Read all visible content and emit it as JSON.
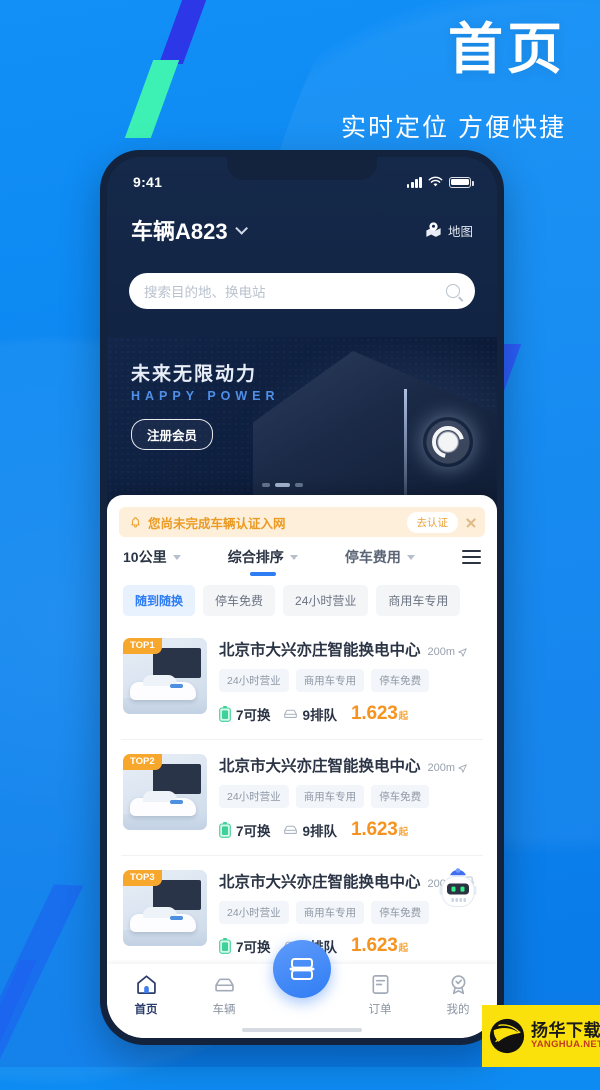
{
  "hero": {
    "title": "首页",
    "subtitle": "实时定位 方便快捷"
  },
  "colors": {
    "page_bg": "#0e8bf2",
    "stripe_dark_blue": "#2c37e8",
    "stripe_mint": "#3df1b4",
    "accent_blue": "#2f7df4",
    "price_orange": "#f5931e",
    "notice_bg": "#fdefd9",
    "notice_text": "#eb9b24",
    "badge_orange": "#f7a72c"
  },
  "phone": {
    "status": {
      "time": "9:41",
      "signal_icon": "signal-bars-icon",
      "wifi_icon": "wifi-icon",
      "battery_icon": "battery-icon"
    },
    "appbar": {
      "vehicle": "车辆A823",
      "chevron_icon": "chevron-down-icon",
      "map_label": "地图",
      "map_icon": "map-pin-icon"
    },
    "search": {
      "placeholder": "搜索目的地、换电站",
      "value": "",
      "icon": "search-icon"
    },
    "banner": {
      "title": "未来无限动力",
      "subtitle_en": "HAPPY POWER",
      "cta": "注册会员",
      "logo_icon": "brand-logo-icon"
    },
    "notice": {
      "icon": "bell-icon",
      "text": "您尚未完成车辆认证入网",
      "action": "去认证",
      "close_icon": "close-icon"
    },
    "filters": [
      {
        "label": "10公里",
        "active": false,
        "caret_icon": "caret-down-icon"
      },
      {
        "label": "综合排序",
        "active": true,
        "caret_icon": "caret-down-icon"
      },
      {
        "label": "停车费用",
        "active": false,
        "caret_icon": "caret-down-icon"
      }
    ],
    "filter_menu_icon": "hamburger-menu-icon",
    "chips": [
      {
        "label": "随到随换",
        "selected": true
      },
      {
        "label": "停车免费",
        "selected": false
      },
      {
        "label": "24小时营业",
        "selected": false
      },
      {
        "label": "商用车专用",
        "selected": false
      }
    ],
    "stations": [
      {
        "badge": "TOP1",
        "title": "北京市大兴亦庄智能换电中心",
        "distance": "200m",
        "tags": [
          "24小时营业",
          "商用车专用",
          "停车免费"
        ],
        "available_label": "7可换",
        "queue_label": "9排队",
        "price": "1.623",
        "price_suffix": "起"
      },
      {
        "badge": "TOP2",
        "title": "北京市大兴亦庄智能换电中心",
        "distance": "200m",
        "tags": [
          "24小时营业",
          "商用车专用",
          "停车免费"
        ],
        "available_label": "7可换",
        "queue_label": "9排队",
        "price": "1.623",
        "price_suffix": "起"
      },
      {
        "badge": "TOP3",
        "title": "北京市大兴亦庄智能换电中心",
        "distance": "200m",
        "tags": [
          "24小时营业",
          "商用车专用",
          "停车免费"
        ],
        "available_label": "7可换",
        "queue_label": "9排队",
        "price": "1.623",
        "price_suffix": "起"
      }
    ],
    "assistant_icon": "robot-assistant-icon",
    "tabs": [
      {
        "label": "首页",
        "icon": "home-icon",
        "active": true
      },
      {
        "label": "车辆",
        "icon": "car-icon",
        "active": false
      },
      {
        "label": "订单",
        "icon": "order-list-icon",
        "active": false
      },
      {
        "label": "我的",
        "icon": "profile-icon",
        "active": false
      }
    ],
    "fab": {
      "icon": "battery-swap-icon"
    }
  },
  "watermark": {
    "cn": "扬华下载",
    "en": "YANGHUA.NET",
    "icon": "globe-icon"
  }
}
